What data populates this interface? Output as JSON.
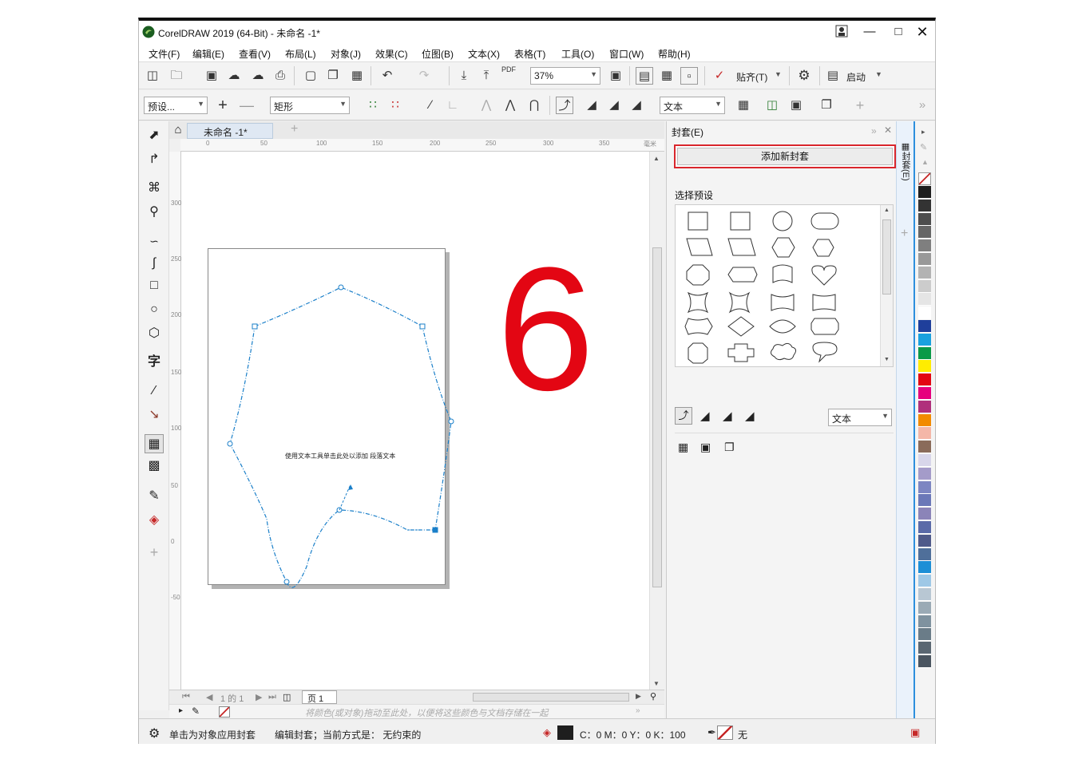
{
  "window": {
    "title": "CorelDRAW 2019 (64-Bit) - 未命名 -1*",
    "controls": [
      "minimize-icon",
      "maximize-icon",
      "close-icon"
    ]
  },
  "menu": [
    "文件(F)",
    "编辑(E)",
    "查看(V)",
    "布局(L)",
    "对象(J)",
    "效果(C)",
    "位图(B)",
    "文本(X)",
    "表格(T)",
    "工具(O)",
    "窗口(W)",
    "帮助(H)"
  ],
  "toolbar": {
    "zoom": "37%",
    "snap_label": "贴齐(T)",
    "launch_label": "启动",
    "pdf_label": "PDF"
  },
  "propbar": {
    "preset": "预设...",
    "shape": "矩形",
    "text_mode": "文本"
  },
  "document": {
    "tab": "未命名 -1*",
    "page_text": "使用文本工具单击此处以添加 段落文本",
    "big_number": "6",
    "big_number_color": "#e30613",
    "envelope_color": "#1a7fc9"
  },
  "rulers": {
    "h_ticks": [
      "0",
      "50",
      "100",
      "150",
      "200",
      "250",
      "300",
      "350"
    ],
    "h_unit": "毫米",
    "v_ticks": [
      "300",
      "250",
      "200",
      "150",
      "100",
      "50",
      "0",
      "-50"
    ]
  },
  "navigator": {
    "page_info": "1 的 1",
    "page_tab": "页 1"
  },
  "color_docker_hint": "将颜色(或对象)拖动至此处，以便将这些颜色与文档存储在一起",
  "docker": {
    "title": "封套(E)",
    "add_button": "添加新封套",
    "preset_label": "选择预设",
    "mode_select": "文本",
    "side_tab": "封套(E)"
  },
  "status": {
    "hint": "单击为对象应用封套",
    "mode": "编辑封套；当前方式是： 无约束的",
    "fill_cmyk": "C：0 M：0 Y：0 K：100",
    "outline": "无"
  },
  "palette_colors": [
    "#1e1e1e",
    "#333333",
    "#4d4d4d",
    "#666666",
    "#7f7f7f",
    "#999999",
    "#b3b3b3",
    "#cccccc",
    "#e5e5e5",
    "#ffffff",
    "#1f3f9b",
    "#1aa1de",
    "#0a9a48",
    "#ffed00",
    "#e30613",
    "#e6007e",
    "#b0307c",
    "#f28b00",
    "#f4b7a8",
    "#8a6b5a",
    "#d8d6ea",
    "#a49bc9",
    "#7d86c2",
    "#6b78b8",
    "#8b84b8",
    "#5a6aa8",
    "#4f5a8a",
    "#4f6f9a",
    "#1c8fd6",
    "#9ec8e6",
    "#b8c7d3",
    "#9aaab5",
    "#7f929f",
    "#6a7c88",
    "#5a6772",
    "#4a5560"
  ]
}
